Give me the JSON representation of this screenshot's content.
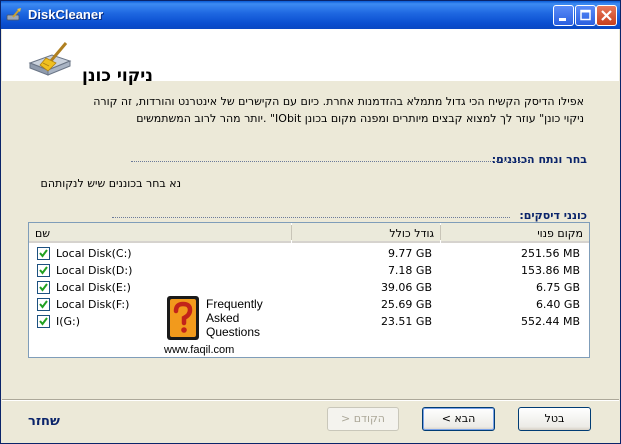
{
  "window": {
    "title": "DiskCleaner"
  },
  "titlebar": {
    "minimize": "minimize-icon",
    "maximize": "maximize-icon",
    "close": "close-icon"
  },
  "header": {
    "title": "ניקוי כונן",
    "icon": "broom-disk-icon"
  },
  "description": {
    "line1": "אפילו הדיסק הקשיח הכי גדול מתמלא בהזדמנות אחרת. כיום עם הקישרים של אינטרנט והורדות, זה קורה",
    "line2": "ניקוי כונן\" עוזר לך למצוא קבצים מיותרים ומפנה מקום בכונן IObit\" .יותר מהר לרוב המשתמשים"
  },
  "select_section": {
    "label": "בחר ונתח הכוננים:",
    "instruction": "נא בחר בכוננים שיש לנקותהם"
  },
  "drives_section": {
    "label": "כונני דיסקים:",
    "columns": {
      "name": "שם",
      "total": "גודל כולל",
      "free": "מקום פנוי"
    },
    "rows": [
      {
        "name": "Local Disk(C:)",
        "total": "9.77 GB",
        "free": "251.56 MB",
        "checked": true
      },
      {
        "name": "Local Disk(D:)",
        "total": "7.18 GB",
        "free": "153.86 MB",
        "checked": true
      },
      {
        "name": "Local Disk(E:)",
        "total": "39.06 GB",
        "free": "6.75 GB",
        "checked": true
      },
      {
        "name": "Local Disk(F:)",
        "total": "25.69 GB",
        "free": "6.40 GB",
        "checked": true
      },
      {
        "name": "I(G:)",
        "total": "23.51 GB",
        "free": "552.44 MB",
        "checked": true
      }
    ]
  },
  "watermark": {
    "line1": "Frequently",
    "line2": "Asked",
    "line3": "Questions",
    "site": "www.faqil.com"
  },
  "footer": {
    "brand": "שחזר",
    "back_label": "הקודם <",
    "next_label": "הבא >",
    "cancel_label": "בטל"
  },
  "colors": {
    "title_bar": "#0a5bd6",
    "section_label": "#0a246a",
    "checkbox_check": "#21a121"
  }
}
